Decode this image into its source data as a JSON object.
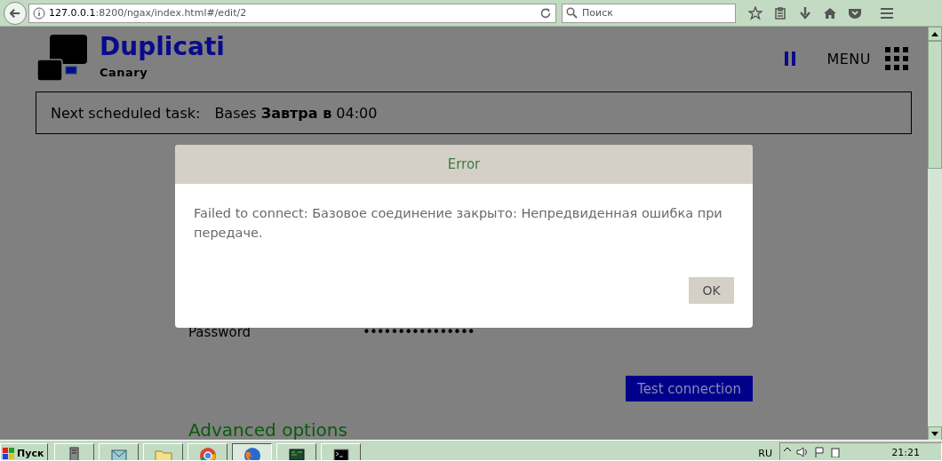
{
  "browser": {
    "url_host": "127.0.0.1",
    "url_path": ":8200/ngax/index.html#/edit/2",
    "search_placeholder": "Поиск"
  },
  "app": {
    "title": "Duplicati",
    "subtitle": "Canary",
    "menu_label": "MENU"
  },
  "schedule": {
    "label": "Next scheduled task:",
    "name": "Bases",
    "when": "Завтра в",
    "time": "04:00"
  },
  "form": {
    "password_label": "Password",
    "password_value": "••••••••••••••••",
    "test_button": "Test connection",
    "advanced_link": "Advanced options"
  },
  "dialog": {
    "title": "Error",
    "message": "Failed to connect: Базовое соединение закрыто: Непредвиденная ошибка при передаче.",
    "button": "OK"
  },
  "taskbar": {
    "start": "Пуск",
    "language": "RU",
    "time": "21:21"
  }
}
